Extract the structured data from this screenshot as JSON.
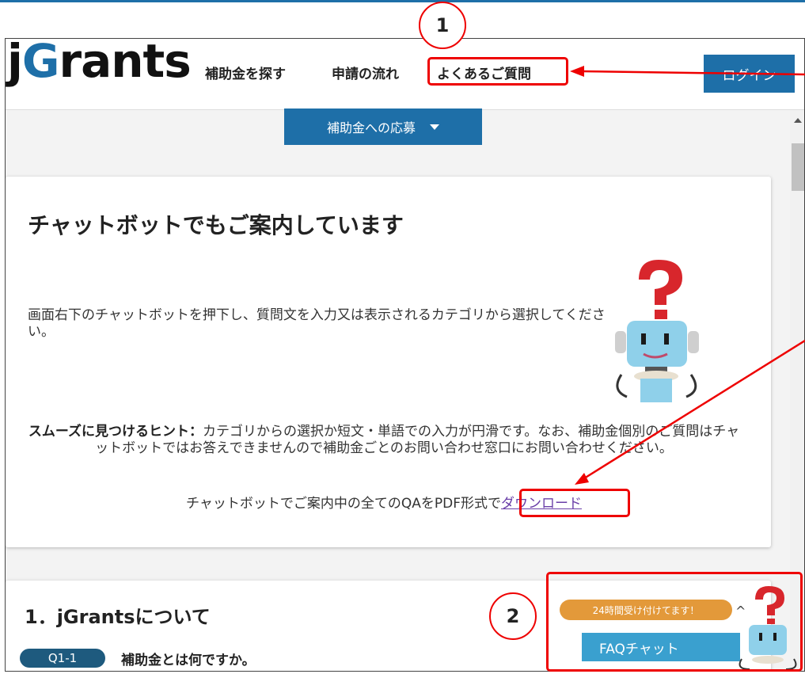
{
  "header": {
    "logo_j": "j",
    "logo_g": "G",
    "logo_rest": "rants",
    "nav": [
      "補助金を探す",
      "申請の流れ",
      "よくあるご質問"
    ],
    "login": "ログイン"
  },
  "apply_button": "補助金への応募",
  "chatbot_card": {
    "title": "チャットボットでもご案内しています",
    "description": "画面右下のチャットボットを押下し、質問文を入力又は表示されるカテゴリから選択してください。",
    "hint_label": "スムーズに見つけるヒント：",
    "hint_text": "カテゴリからの選択か短文・単語での入力が円滑です。なお、補助金個別のご質問はチャットボットではお答えできませんので補助金ごとのお問い合わせ窓口にお問い合わせください。",
    "download_prefix": "チャットボットでご案内中の全てのQAをPDF形式で",
    "download_link": "ダウンロード"
  },
  "faq_section": {
    "title": "1．jGrantsについて",
    "question_id": "Q1-1",
    "question_text": "補助金とは何ですか。"
  },
  "chat_widget": {
    "bubble": "24時間受け付けてます！",
    "caret": "^",
    "button": "FAQチャット"
  },
  "annotations": {
    "one": "1",
    "two": "2"
  },
  "colors": {
    "brand": "#1e6fa8",
    "annotation": "#e00000",
    "chat_orange": "#e3993a",
    "chat_blue": "#3aa0cf"
  }
}
